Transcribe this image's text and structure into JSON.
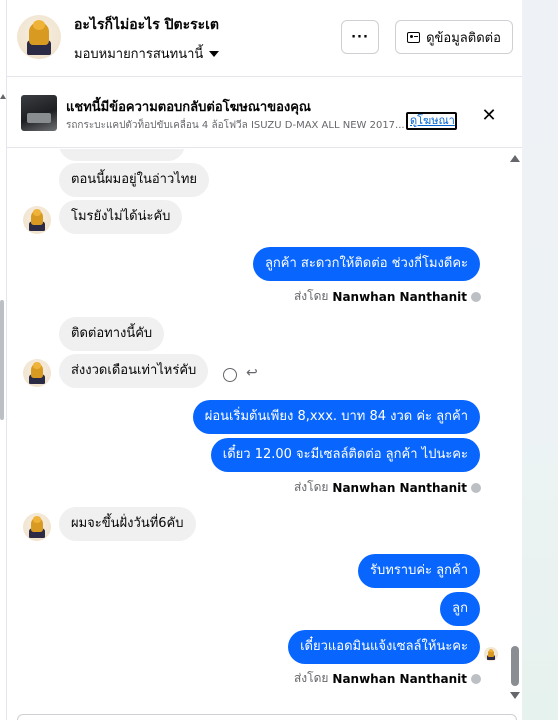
{
  "header": {
    "page_name": "อะไรก็ไม่อะไร ปิตะระเต",
    "subtitle": "มอบหมายการสนทนานี้",
    "more_label": "···",
    "contact_label": "ดูข้อมูลติดต่อ"
  },
  "ad_banner": {
    "title": "แชทนี้มีข้อความตอบกลับต่อโฆษณาของคุณ",
    "description": "รถกระบะแคปตัวท็อปขับเคลื่อน 4 ล้อโฟวีล ISUZU D-MAX ALL NEW 2017...",
    "link_label": "ดูโฆษณา",
    "close_label": "✕"
  },
  "messages": [
    {
      "side": "in",
      "text": "ตอนนี้ผมอยู่ในอ่าวไทย"
    },
    {
      "side": "in",
      "text": "โมรยังไม่ได้น่ะคับ"
    },
    {
      "side": "out",
      "text": "ลูกค้า สะดวกให้ติดต่อ ช่วงกี่โมงดีคะ"
    },
    {
      "side": "in",
      "text": "ติดต่อทางนี้คับ"
    },
    {
      "side": "in",
      "text": "ส่งงวดเดือนเท่าไหร่คับ"
    },
    {
      "side": "out",
      "text": "ผ่อนเริ่มต้นเพียง 8,xxx. บาท 84 งวด ค่ะ  ลูกค้า"
    },
    {
      "side": "out",
      "text": "เดี๋ยว 12.00 จะมีเซลล์ติดต่อ ลูกค้า ไปนะคะ"
    },
    {
      "side": "in",
      "text": "ผมจะขึ้นฝั่งวันที่6คับ"
    },
    {
      "side": "out",
      "text": "รับทราบค่ะ  ลูกค้า"
    },
    {
      "side": "out",
      "text": "ลูก"
    },
    {
      "side": "out",
      "text": "เดี๋ยวแอดมินแจ้งเซลล์ให้นะคะ"
    }
  ],
  "sent_by": {
    "prefix": "ส่งโดย",
    "name": "Nanwhan Nanthanit"
  },
  "icons": {
    "reaction": "smiley-icon",
    "reply": "reply-icon",
    "info": "info-icon"
  },
  "colors": {
    "outgoing_bubble": "#0866ff",
    "incoming_bubble": "#f0f0f0",
    "link": "#0064d1"
  }
}
